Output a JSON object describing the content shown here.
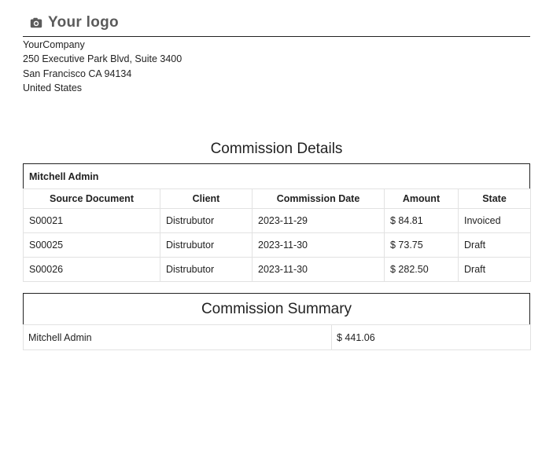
{
  "logo": {
    "icon": "camera-icon",
    "text": "Your logo"
  },
  "company": {
    "name": "YourCompany",
    "street": "250 Executive Park Blvd, Suite 3400",
    "city_line": "San Francisco CA 94134",
    "country": "United States"
  },
  "details": {
    "title": "Commission Details",
    "agent": "Mitchell Admin",
    "columns": [
      "Source Document",
      "Client",
      "Commission Date",
      "Amount",
      "State"
    ],
    "rows": [
      {
        "source": "S00021",
        "client": "Distrubutor",
        "date": "2023-11-29",
        "amount": "$ 84.81",
        "state": "Invoiced"
      },
      {
        "source": "S00025",
        "client": "Distrubutor",
        "date": "2023-11-30",
        "amount": "$ 73.75",
        "state": "Draft"
      },
      {
        "source": "S00026",
        "client": "Distrubutor",
        "date": "2023-11-30",
        "amount": "$ 282.50",
        "state": "Draft"
      }
    ]
  },
  "summary": {
    "title": "Commission Summary",
    "rows": [
      {
        "agent": "Mitchell Admin",
        "total": "$ 441.06"
      }
    ]
  }
}
